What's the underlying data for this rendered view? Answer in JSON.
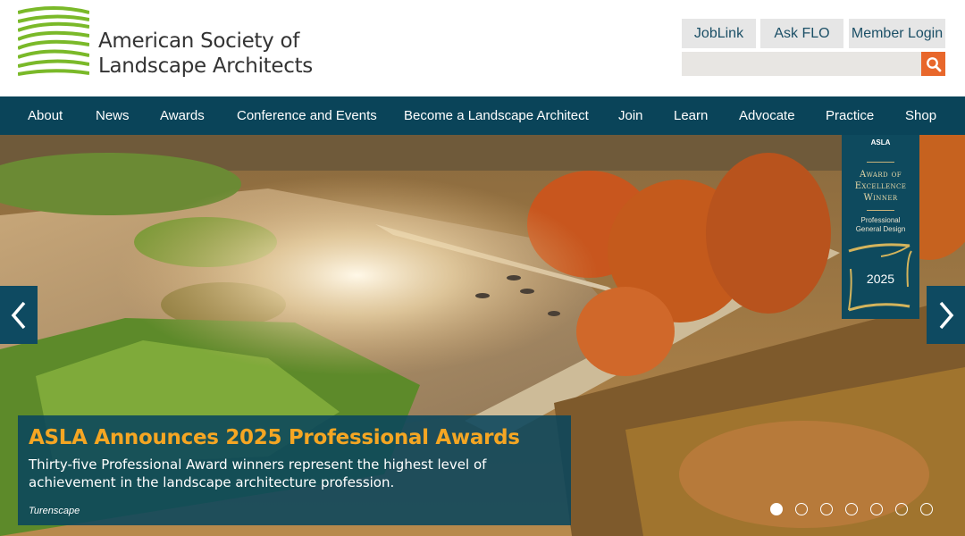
{
  "site": {
    "name_line1": "American Society of",
    "name_line2": "Landscape Architects"
  },
  "utility": {
    "joblink": "JobLink",
    "askflo": "Ask FLO",
    "member_login": "Member Login",
    "search_placeholder": "",
    "search_icon": "search-icon"
  },
  "nav": {
    "items": [
      {
        "label": "About"
      },
      {
        "label": "News"
      },
      {
        "label": "Awards"
      },
      {
        "label": "Conference and Events"
      },
      {
        "label": "Become a Landscape Architect"
      },
      {
        "label": "Join"
      },
      {
        "label": "Learn"
      },
      {
        "label": "Advocate"
      },
      {
        "label": "Practice"
      },
      {
        "label": "Shop"
      }
    ]
  },
  "hero": {
    "badge": {
      "org": "ASLA",
      "line1": "Award of",
      "line2": "Excellence",
      "line3": "Winner",
      "category1": "Professional",
      "category2": "General Design",
      "year": "2025"
    },
    "title": "ASLA Announces 2025 Professional Awards",
    "body": "Thirty-five Professional Award winners represent the highest level of achievement in the landscape architecture profession.",
    "credit": "Turenscape",
    "slides_total": 7,
    "active_slide": 1
  },
  "colors": {
    "nav_bg": "#0a4459",
    "accent_orange": "#e8672b",
    "title_gold": "#f5a623",
    "logo_green": "#7ab929"
  }
}
